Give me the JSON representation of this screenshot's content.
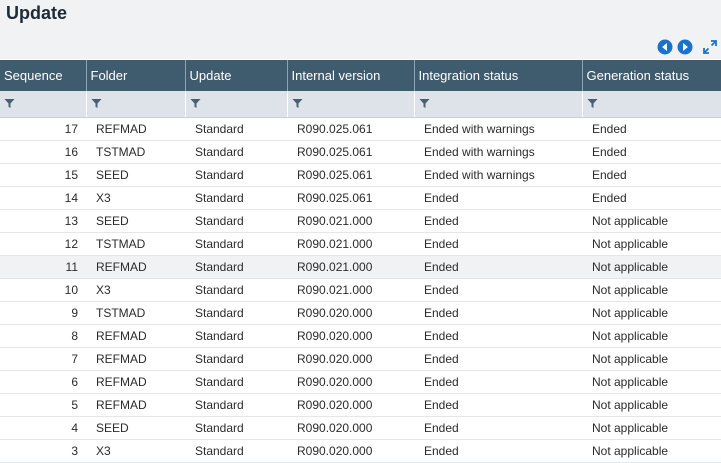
{
  "page": {
    "title": "Update"
  },
  "toolbar": {
    "prev_icon": "circle-left-arrow-icon",
    "next_icon": "circle-right-arrow-icon",
    "expand_icon": "expand-arrows-icon",
    "accent_color": "#1a73c8"
  },
  "table": {
    "columns": [
      "Sequence",
      "Folder",
      "Update",
      "Internal version",
      "Integration status",
      "Generation status"
    ],
    "filter_icon": "filter-funnel-icon",
    "rows": [
      [
        "17",
        "REFMAD",
        "Standard",
        "R090.025.061",
        "Ended with warnings",
        "Ended"
      ],
      [
        "16",
        "TSTMAD",
        "Standard",
        "R090.025.061",
        "Ended with warnings",
        "Ended"
      ],
      [
        "15",
        "SEED",
        "Standard",
        "R090.025.061",
        "Ended with warnings",
        "Ended"
      ],
      [
        "14",
        "X3",
        "Standard",
        "R090.025.061",
        "Ended",
        "Ended"
      ],
      [
        "13",
        "SEED",
        "Standard",
        "R090.021.000",
        "Ended",
        "Not applicable"
      ],
      [
        "12",
        "TSTMAD",
        "Standard",
        "R090.021.000",
        "Ended",
        "Not applicable"
      ],
      [
        "11",
        "REFMAD",
        "Standard",
        "R090.021.000",
        "Ended",
        "Not applicable"
      ],
      [
        "10",
        "X3",
        "Standard",
        "R090.021.000",
        "Ended",
        "Not applicable"
      ],
      [
        "9",
        "TSTMAD",
        "Standard",
        "R090.020.000",
        "Ended",
        "Not applicable"
      ],
      [
        "8",
        "REFMAD",
        "Standard",
        "R090.020.000",
        "Ended",
        "Not applicable"
      ],
      [
        "7",
        "REFMAD",
        "Standard",
        "R090.020.000",
        "Ended",
        "Not applicable"
      ],
      [
        "6",
        "REFMAD",
        "Standard",
        "R090.020.000",
        "Ended",
        "Not applicable"
      ],
      [
        "5",
        "REFMAD",
        "Standard",
        "R090.020.000",
        "Ended",
        "Not applicable"
      ],
      [
        "4",
        "SEED",
        "Standard",
        "R090.020.000",
        "Ended",
        "Not applicable"
      ],
      [
        "3",
        "X3",
        "Standard",
        "R090.020.000",
        "Ended",
        "Not applicable"
      ]
    ]
  }
}
